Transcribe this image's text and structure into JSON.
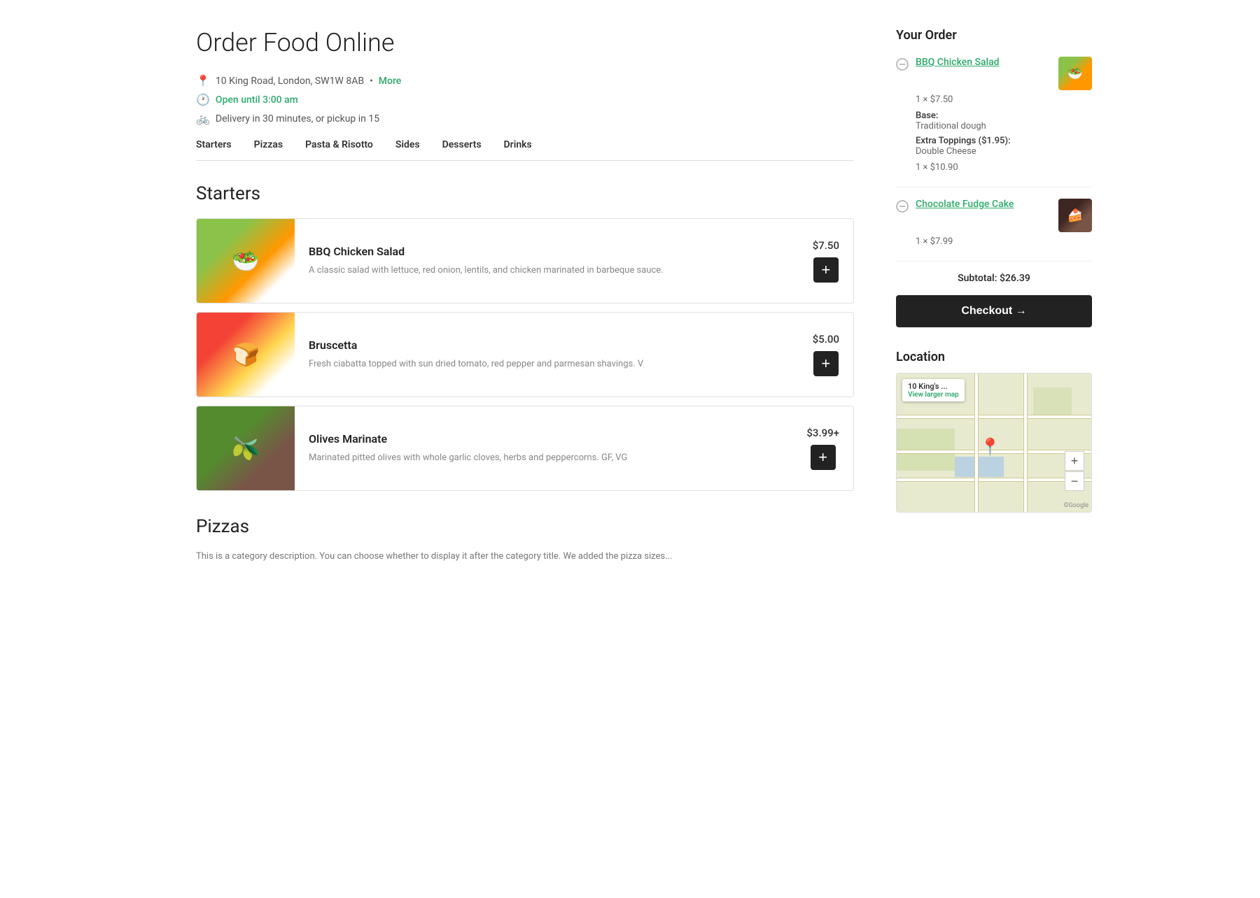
{
  "page": {
    "title": "Order Food Online"
  },
  "restaurant": {
    "address": "10 King Road, London, SW1W 8AB",
    "address_link_label": "More",
    "status": "Open until 3:00 am",
    "delivery_info": "Delivery in 30 minutes, or pickup in 15"
  },
  "nav": {
    "tabs": [
      {
        "label": "Starters"
      },
      {
        "label": "Pizzas"
      },
      {
        "label": "Pasta & Risotto"
      },
      {
        "label": "Sides"
      },
      {
        "label": "Desserts"
      },
      {
        "label": "Drinks"
      }
    ]
  },
  "sections": [
    {
      "id": "starters",
      "title": "Starters",
      "items": [
        {
          "name": "BBQ Chicken Salad",
          "description": "A classic salad with lettuce, red onion, lentils, and chicken marinated in barbeque sauce.",
          "price": "$7.50",
          "img_type": "salad"
        },
        {
          "name": "Bruscetta",
          "description": "Fresh ciabatta topped with sun dried tomato, red pepper and parmesan shavings. V",
          "price": "$5.00",
          "img_type": "bruscetta"
        },
        {
          "name": "Olives Marinate",
          "description": "Marinated pitted olives with whole garlic cloves, herbs and peppercorns. GF, VG",
          "price": "$3.99+",
          "img_type": "olives"
        }
      ]
    },
    {
      "id": "pizzas",
      "title": "Pizzas",
      "description": "This is a category description. You can choose whether to display it after the category title. We added the pizza sizes..."
    }
  ],
  "order": {
    "title": "Your Order",
    "items": [
      {
        "name": "BBQ Chicken Salad",
        "qty_price": "1 × $7.50",
        "base_label": "Base:",
        "base_value": "Traditional dough",
        "extra_label": "Extra Toppings ($1.95):",
        "extra_value": "Double Cheese",
        "final_qty": "1 × $10.90",
        "img_type": "salad"
      },
      {
        "name": "Chocolate Fudge Cake",
        "qty_price": "1 × $7.99",
        "img_type": "cake"
      }
    ],
    "subtotal_label": "Subtotal:",
    "subtotal_value": "$26.39",
    "checkout_label": "Checkout →"
  },
  "location": {
    "title": "Location",
    "map_label": "10 King's ...",
    "view_larger_map": "View larger map"
  }
}
